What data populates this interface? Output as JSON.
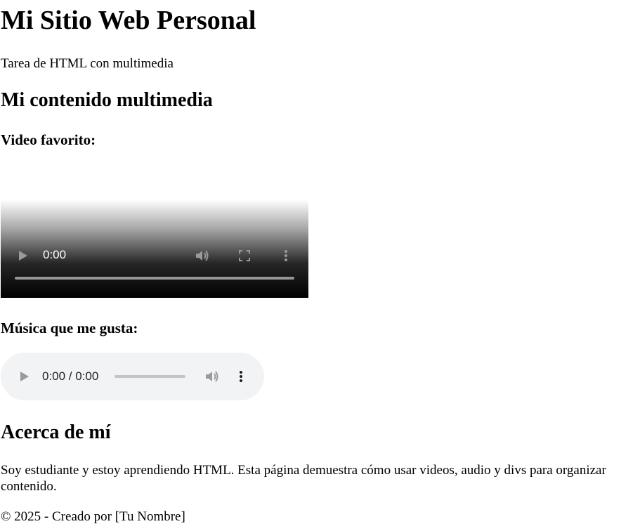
{
  "header": {
    "title": "Mi Sitio Web Personal",
    "subtitle": "Tarea de HTML con multimedia"
  },
  "multimedia": {
    "heading": "Mi contenido multimedia",
    "video": {
      "label": "Video favorito:",
      "time": "0:00",
      "icons": [
        "play-icon",
        "volume-icon",
        "fullscreen-icon",
        "more-options-icon"
      ]
    },
    "audio": {
      "label": "Música que me gusta:",
      "time": "0:00 / 0:00",
      "icons": [
        "play-icon",
        "volume-icon",
        "more-options-icon"
      ]
    }
  },
  "about": {
    "heading": "Acerca de mí",
    "text": "Soy estudiante y estoy aprendiendo HTML. Esta página demuestra cómo usar videos, audio y divs para organizar contenido."
  },
  "footer": {
    "text": "© 2025 - Creado por [Tu Nombre]"
  },
  "colors": {
    "text": "#000000",
    "background": "#ffffff",
    "audio_bg": "#f1f3f4"
  }
}
